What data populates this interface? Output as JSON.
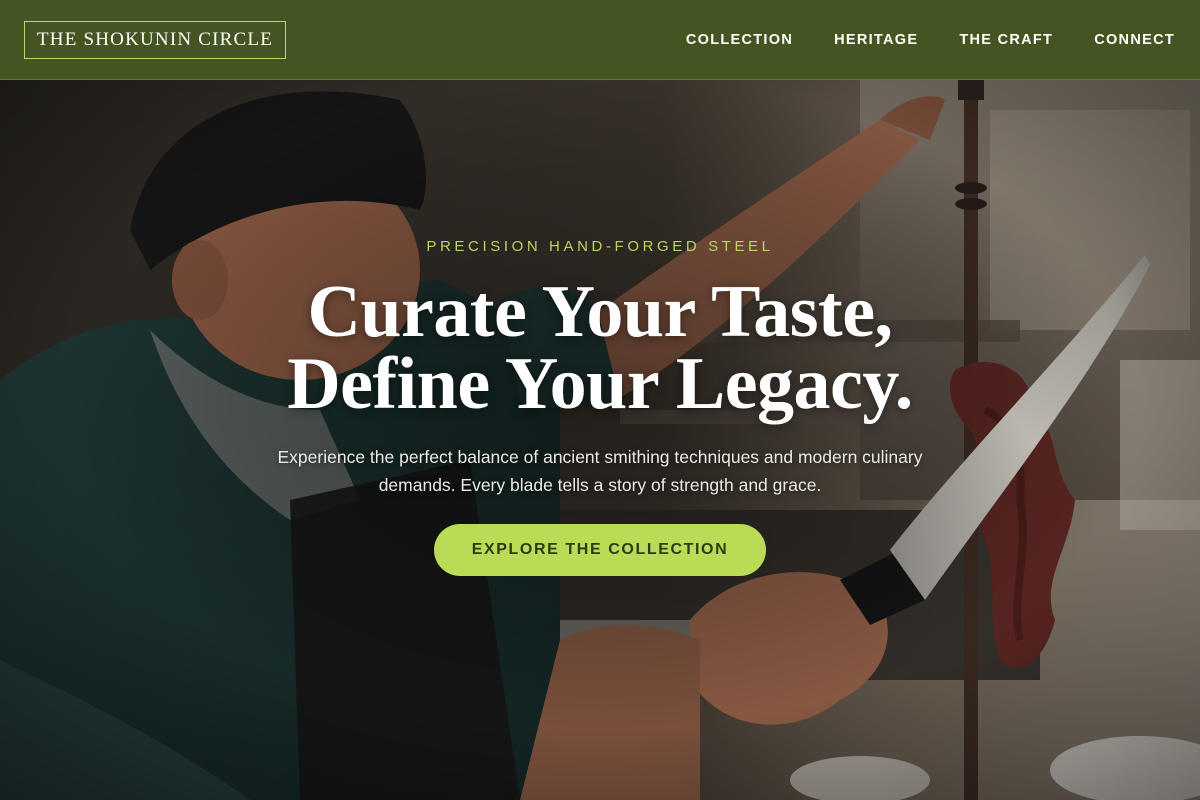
{
  "header": {
    "logo": "THE SHOKUNIN CIRCLE",
    "nav": [
      "COLLECTION",
      "HERITAGE",
      "THE CRAFT",
      "CONNECT"
    ]
  },
  "hero": {
    "eyebrow": "PRECISION HAND-FORGED STEEL",
    "headline_line1": "Curate Your Taste,",
    "headline_line2": "Define Your Legacy.",
    "description": "Experience the perfect balance of ancient smithing techniques and modern culinary demands. Every blade tells a story of strength and grace.",
    "cta_label": "EXPLORE THE COLLECTION"
  },
  "colors": {
    "header_bg": "#445522",
    "accent": "#b9db55",
    "logo_border": "#b6d86a",
    "eyebrow": "#b7d65c",
    "cta_text": "#2d3b14"
  }
}
